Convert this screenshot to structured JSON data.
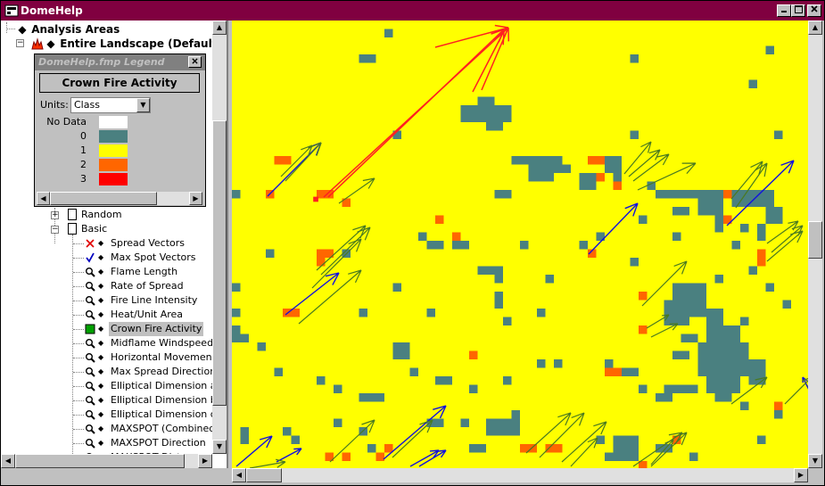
{
  "window": {
    "title": "DomeHelp"
  },
  "tree": {
    "root_label": "Analysis Areas",
    "landscape_label": "Entire Landscape (Default)",
    "folders": [
      {
        "label": "Random"
      },
      {
        "label": "Basic"
      }
    ],
    "layers": [
      {
        "label": "Spread Vectors",
        "icon": "red-x-icon"
      },
      {
        "label": "Max Spot Vectors",
        "icon": "blue-check-icon"
      },
      {
        "label": "Flame Length",
        "icon": "magnifier-icon"
      },
      {
        "label": "Rate of Spread",
        "icon": "magnifier-icon"
      },
      {
        "label": "Fire Line Intensity",
        "icon": "magnifier-icon"
      },
      {
        "label": "Heat/Unit Area",
        "icon": "magnifier-icon"
      },
      {
        "label": "Crown Fire Activity",
        "icon": "green-square-icon",
        "selected": true
      },
      {
        "label": "Midflame Windspeed",
        "icon": "magnifier-icon"
      },
      {
        "label": "Horizontal Movement Ra",
        "icon": "magnifier-icon"
      },
      {
        "label": "Max Spread Direction",
        "icon": "magnifier-icon"
      },
      {
        "label": "Elliptical Dimension a",
        "icon": "magnifier-icon"
      },
      {
        "label": "Elliptical Dimension b",
        "icon": "magnifier-icon"
      },
      {
        "label": "Elliptical Dimension c",
        "icon": "magnifier-icon"
      },
      {
        "label": "MAXSPOT (Combined)",
        "icon": "magnifier-icon"
      },
      {
        "label": "MAXSPOT Direction",
        "icon": "magnifier-icon"
      },
      {
        "label": "MAXSPOT Distance",
        "icon": "magnifier-icon"
      }
    ]
  },
  "legend": {
    "title": "DomeHelp.fmp Legend",
    "heading_button": "Crown Fire Activity",
    "units_label": "Units:",
    "units_value": "Class",
    "entries": [
      {
        "label": "No Data",
        "color": "#ffffff"
      },
      {
        "label": "0",
        "color": "#4a8080"
      },
      {
        "label": "1",
        "color": "#ffff00"
      },
      {
        "label": "2",
        "color": "#ff6600"
      },
      {
        "label": "3",
        "color": "#ff0000"
      }
    ]
  },
  "colors": {
    "titlebar": "#800040",
    "map_background": "#ffff00",
    "class0": "#4a8080",
    "class2": "#ff6600",
    "spread_vector": "#ff2020",
    "max_spot_vector": "#1010e0",
    "green_vector": "#4a7a20"
  }
}
